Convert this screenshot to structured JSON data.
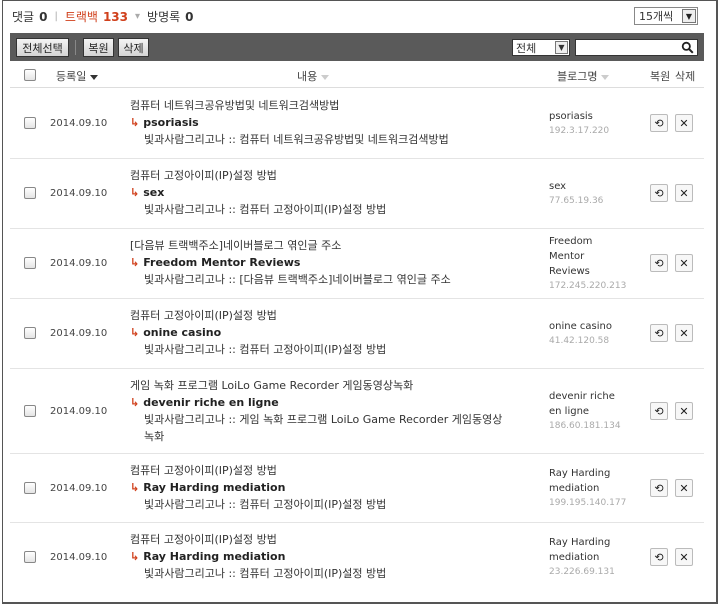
{
  "summary": {
    "comments_label": "댓글",
    "comments_count": "0",
    "trackback_label": "트랙백",
    "trackback_count": "133",
    "guestbook_label": "방명록",
    "guestbook_count": "0"
  },
  "per_page": {
    "value": "15개씩"
  },
  "toolbar": {
    "select_all_label": "전체선택",
    "restore_label": "복원",
    "delete_label": "삭제",
    "filter_value": "전체",
    "search_placeholder": ""
  },
  "header": {
    "date_label": "등록일",
    "content_label": "내용",
    "blog_label": "블로그명",
    "restore_label": "복원",
    "delete_label": "삭제"
  },
  "rows": [
    {
      "date": "2014.09.10",
      "title": "컴퓨터 네트워크공유방법및 네트워크검색방법",
      "source": "psoriasis",
      "excerpt": "빛과사람그리고나 :: 컴퓨터 네트워크공유방법및 네트워크검색방법",
      "blog_name": "psoriasis",
      "ip": "192.3.17.220"
    },
    {
      "date": "2014.09.10",
      "title": "컴퓨터 고정아이피(IP)설정 방법",
      "source": "sex",
      "excerpt": "빛과사람그리고나 :: 컴퓨터 고정아이피(IP)설정 방법",
      "blog_name": "sex",
      "ip": "77.65.19.36"
    },
    {
      "date": "2014.09.10",
      "title": "[다음뷰 트랙백주소]네이버블로그 엮인글 주소",
      "source": "Freedom Mentor Reviews",
      "excerpt": "빛과사람그리고나 :: [다음뷰 트랙백주소]네이버블로그 엮인글 주소",
      "blog_name": "Freedom Mentor Reviews",
      "ip": "172.245.220.213"
    },
    {
      "date": "2014.09.10",
      "title": "컴퓨터 고정아이피(IP)설정 방법",
      "source": "onine casino",
      "excerpt": "빛과사람그리고나 :: 컴퓨터 고정아이피(IP)설정 방법",
      "blog_name": "onine casino",
      "ip": "41.42.120.58"
    },
    {
      "date": "2014.09.10",
      "title": "게임 녹화 프로그램 LoiLo Game Recorder 게임동영상녹화",
      "source": "devenir riche en ligne",
      "excerpt": "빛과사람그리고나 :: 게임 녹화 프로그램 LoiLo Game Recorder 게임동영상녹화",
      "blog_name": "devenir riche en ligne",
      "ip": "186.60.181.134"
    },
    {
      "date": "2014.09.10",
      "title": "컴퓨터 고정아이피(IP)설정 방법",
      "source": "Ray Harding mediation",
      "excerpt": "빛과사람그리고나 :: 컴퓨터 고정아이피(IP)설정 방법",
      "blog_name": "Ray Harding mediation",
      "ip": "199.195.140.177"
    },
    {
      "date": "2014.09.10",
      "title": "컴퓨터 고정아이피(IP)설정 방법",
      "source": "Ray Harding mediation",
      "excerpt": "빛과사람그리고나 :: 컴퓨터 고정아이피(IP)설정 방법",
      "blog_name": "Ray Harding mediation",
      "ip": "23.226.69.131"
    }
  ],
  "icons": {
    "restore": "restore-icon",
    "delete": "close-icon",
    "search": "search-icon",
    "arrow": "arrow-right-icon"
  },
  "colors": {
    "accent": "#d0401c",
    "toolbar": "#5a5a5a"
  }
}
